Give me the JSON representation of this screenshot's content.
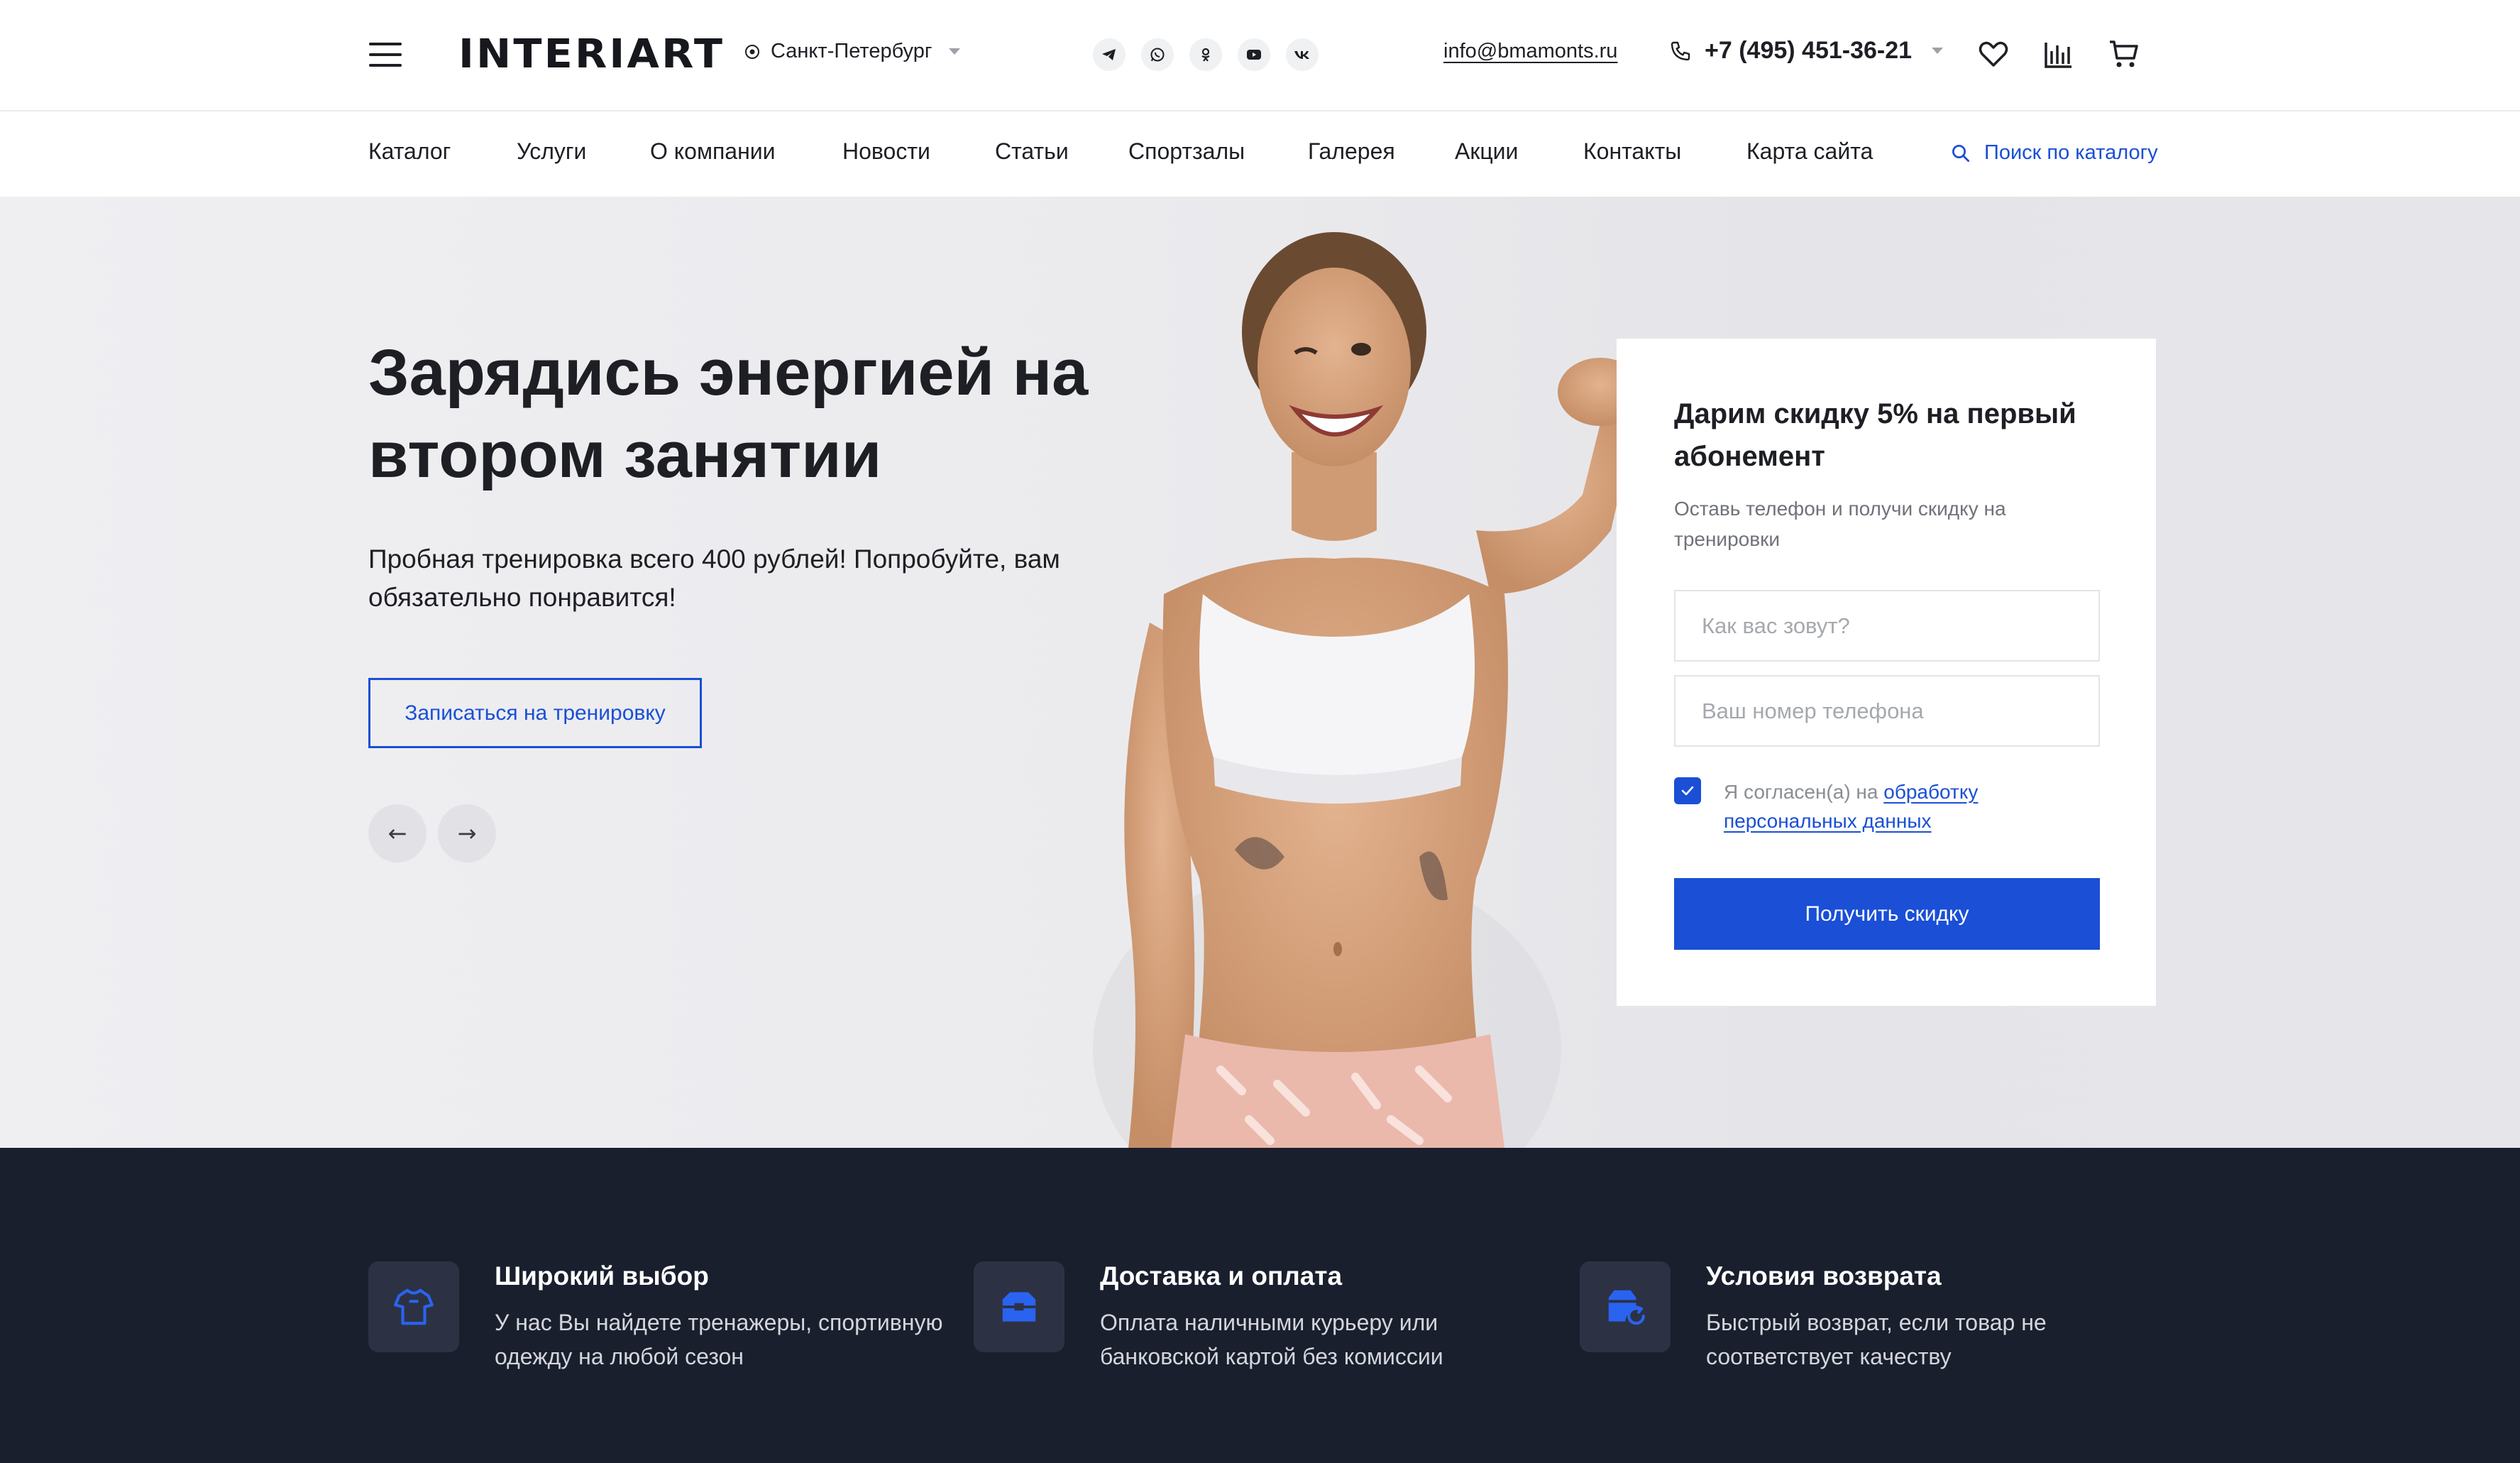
{
  "header": {
    "logo": "INTERIART",
    "city": "Санкт-Петербург",
    "email": "info@bmamonts.ru",
    "phone": "+7 (495) 451-36-21",
    "socials": [
      "telegram-icon",
      "whatsapp-icon",
      "odnoklassniki-icon",
      "youtube-icon",
      "vk-icon"
    ],
    "icons": [
      "favorites-icon",
      "compare-icon",
      "cart-icon"
    ]
  },
  "nav": {
    "items": [
      "Каталог",
      "Услуги",
      "О компании",
      "Новости",
      "Статьи",
      "Спортзалы",
      "Галерея",
      "Акции",
      "Контакты",
      "Карта сайта"
    ],
    "search_label": "Поиск по каталогу"
  },
  "hero": {
    "title": "Зарядись энергией на втором занятии",
    "subtitle": "Пробная тренировка всего 400 рублей! Попробуйте, вам обязательно понравится!",
    "cta_label": "Записаться на тренировку"
  },
  "form": {
    "title": "Дарим скидку 5% на первый абонемент",
    "subtitle": "Оставь телефон и получи скидку на тренировки",
    "name_placeholder": "Как вас зовут?",
    "phone_placeholder": "Ваш номер телефона",
    "consent_prefix": "Я согласен(а) на ",
    "consent_link": "обработку персональных данных",
    "consent_checked": true,
    "submit_label": "Получить скидку"
  },
  "features": [
    {
      "icon": "tshirt-icon",
      "title": "Широкий выбор",
      "text": "У нас Вы найдете тренажеры, спортивную одежду на любой сезон"
    },
    {
      "icon": "delivery-box-icon",
      "title": "Доставка и оплата",
      "text": "Оплата наличными курьеру или банковской картой без комиссии"
    },
    {
      "icon": "return-icon",
      "title": "Условия возврата",
      "text": "Быстрый возврат, если товар не соответствует качеству"
    }
  ],
  "colors": {
    "accent": "#1a4fd6",
    "dark": "#1a1f2e",
    "hero_bg": "#ebebee"
  }
}
